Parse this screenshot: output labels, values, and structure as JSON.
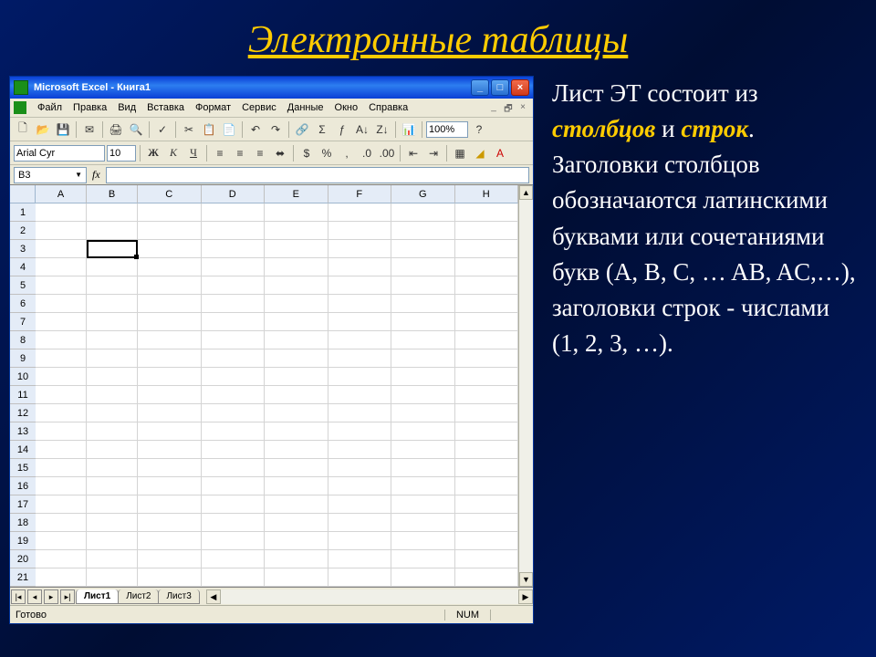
{
  "slide": {
    "title": "Электронные таблицы"
  },
  "window": {
    "title": "Microsoft Excel - Книга1",
    "controls": {
      "min": "_",
      "max": "□",
      "close": "×"
    }
  },
  "menu": {
    "items": [
      "Файл",
      "Правка",
      "Вид",
      "Вставка",
      "Формат",
      "Сервис",
      "Данные",
      "Окно",
      "Справка"
    ],
    "doc_controls": {
      "min": "_",
      "restore": "🗗",
      "close": "×"
    }
  },
  "toolbar1": {
    "zoom": "100%",
    "icons": [
      "new",
      "open",
      "save",
      "sep",
      "mail",
      "sep",
      "print",
      "preview",
      "sep",
      "spell",
      "sep",
      "cut",
      "copy",
      "paste",
      "sep",
      "undo",
      "redo",
      "sep",
      "link",
      "sum",
      "fx",
      "sort-asc",
      "sort-desc",
      "sep",
      "chart",
      "sep",
      "zoom",
      "help"
    ]
  },
  "toolbar2": {
    "font": "Arial Cyr",
    "size": "10",
    "buttons": [
      "Ж",
      "К",
      "Ч"
    ],
    "align_icons": [
      "align-left",
      "align-center",
      "align-right",
      "merge"
    ],
    "num_icons": [
      "currency",
      "percent",
      "comma",
      "inc-dec",
      "dec-dec"
    ],
    "indent_icons": [
      "indent-out",
      "indent-in"
    ],
    "other_icons": [
      "border",
      "fill",
      "font-color"
    ]
  },
  "namebox": {
    "value": "B3",
    "fx": "fx"
  },
  "grid": {
    "columns": [
      "A",
      "B",
      "C",
      "D",
      "E",
      "F",
      "G",
      "H"
    ],
    "rows": 21,
    "selected": {
      "row": 3,
      "col": "B"
    }
  },
  "sheets": {
    "tabs": [
      "Лист1",
      "Лист2",
      "Лист3"
    ],
    "active": 0,
    "nav": [
      "|◂",
      "◂",
      "▸",
      "▸|"
    ]
  },
  "status": {
    "ready": "Готово",
    "num": "NUM"
  },
  "side": {
    "t1": "Лист ЭТ состоит из ",
    "hl1": "столбцов",
    "t2": " и ",
    "hl2": "строк",
    "t3": ". Заголовки столбцов обозначаются латинскими буквами или сочетаниями букв (A, B, C, … AB, AC,…), заголовки строк  - числами (1, 2, 3, …)."
  }
}
